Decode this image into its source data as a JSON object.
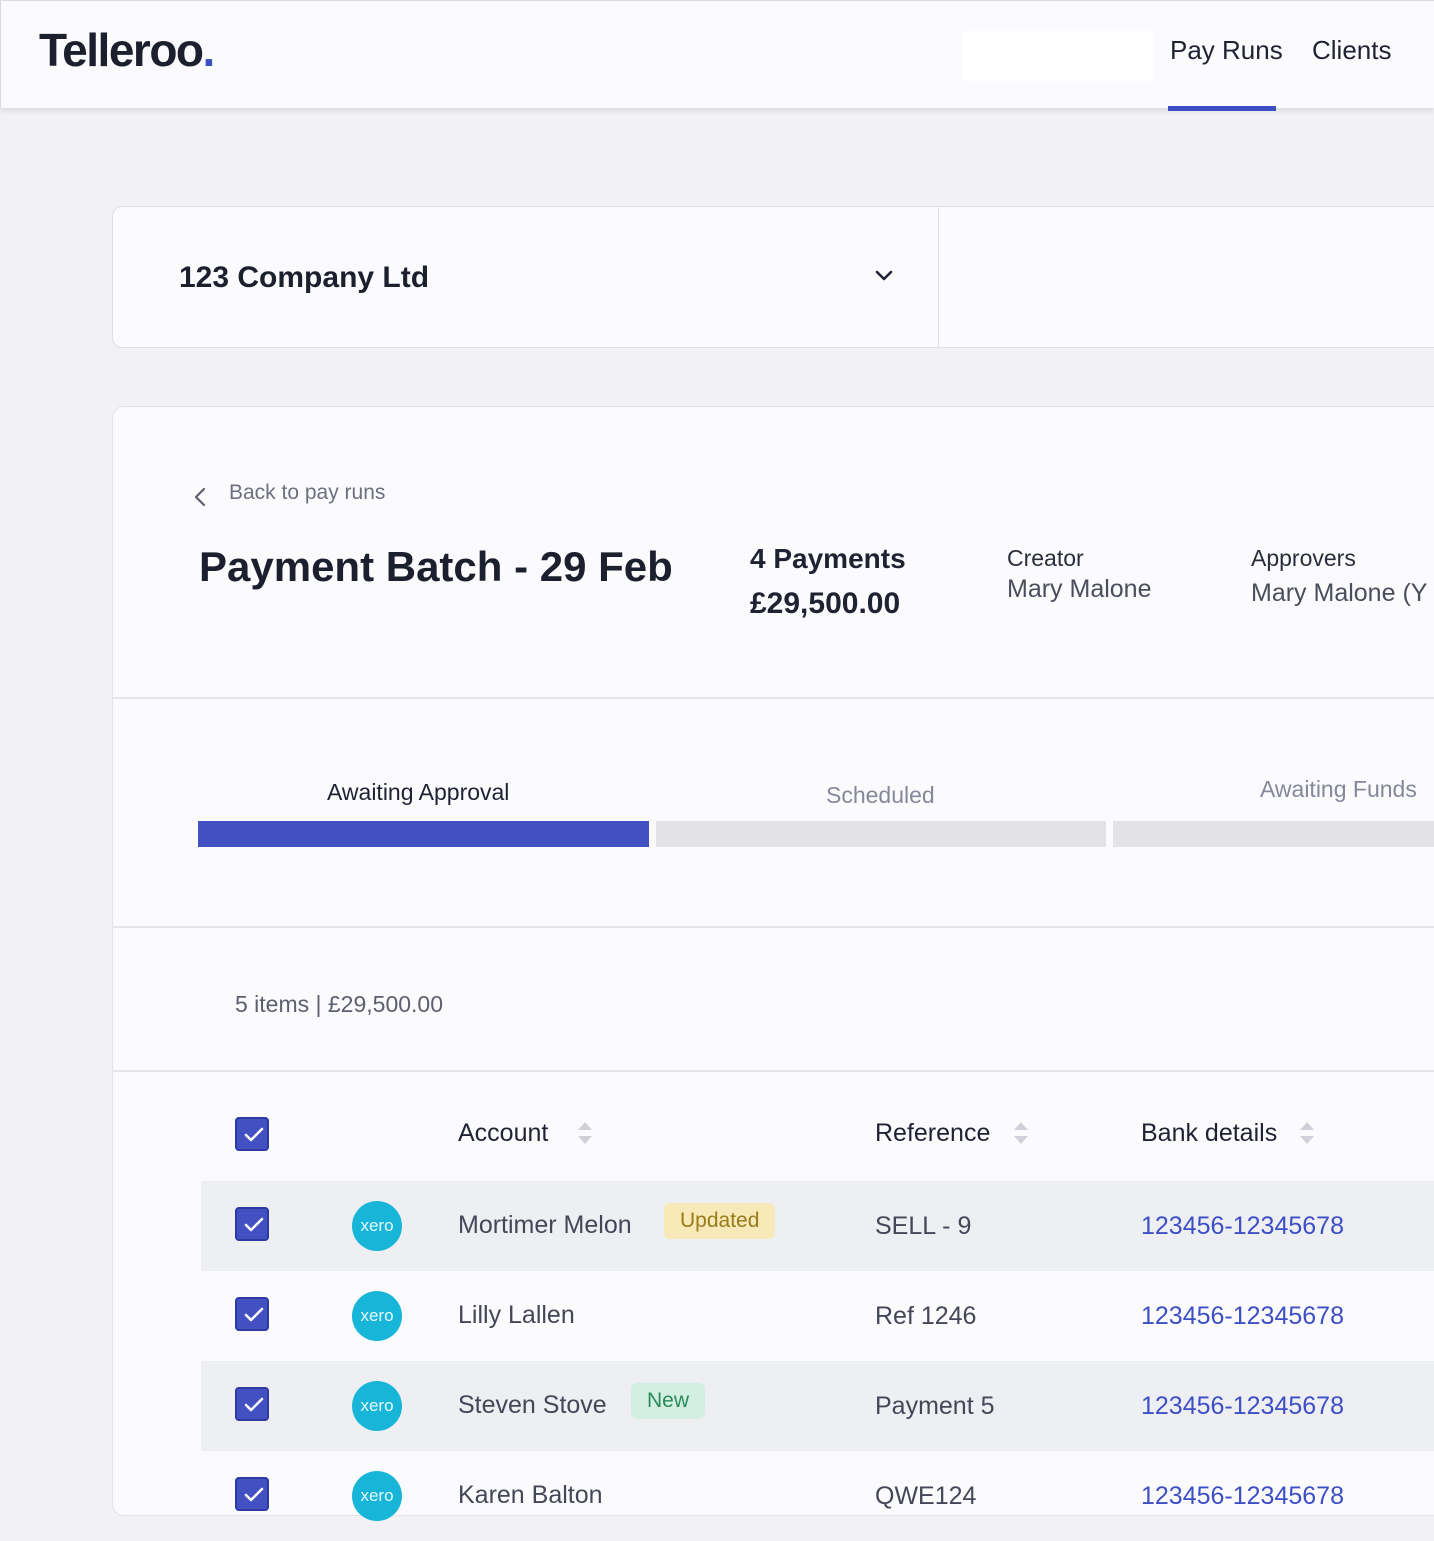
{
  "app": {
    "logo_text": "Telleroo",
    "logo_dot": ".",
    "nav": {
      "pay_runs": "Pay Runs",
      "clients": "Clients"
    }
  },
  "company_selector": {
    "selected": "123 Company Ltd",
    "icon": "chevron-down-icon"
  },
  "batch": {
    "back_label": "Back to pay runs",
    "title": "Payment Batch - 29 Feb",
    "payments_count": "4 Payments",
    "payments_total": "£29,500.00",
    "creator_label": "Creator",
    "creator_value": "Mary Malone",
    "approvers_label": "Approvers",
    "approvers_value": "Mary Malone (Y"
  },
  "progress": {
    "steps": [
      {
        "label": "Awaiting Approval",
        "active": true
      },
      {
        "label": "Scheduled",
        "active": false
      },
      {
        "label": "Awaiting Funds",
        "active": false
      }
    ],
    "colors": {
      "active": "#4250c2",
      "inactive": "#e3e3e6"
    }
  },
  "table": {
    "summary": "5 items | £29,500.00",
    "headers": {
      "account": "Account",
      "reference": "Reference",
      "bank_details": "Bank details"
    },
    "rows": [
      {
        "account": "Mortimer Melon",
        "tag": "Updated",
        "reference": "SELL - 9",
        "bank": "123456-12345678",
        "source": "xero"
      },
      {
        "account": "Lilly Lallen",
        "tag": "",
        "reference": "Ref 1246",
        "bank": "123456-12345678",
        "source": "xero"
      },
      {
        "account": "Steven Stove",
        "tag": "New",
        "reference": "Payment 5",
        "bank": "123456-12345678",
        "source": "xero"
      },
      {
        "account": "Karen Balton",
        "tag": "",
        "reference": "QWE124",
        "bank": "123456-12345678",
        "source": "xero"
      }
    ]
  },
  "colors": {
    "accent": "#4250c2",
    "link": "#3d4fc4",
    "xero": "#17b6d9"
  }
}
